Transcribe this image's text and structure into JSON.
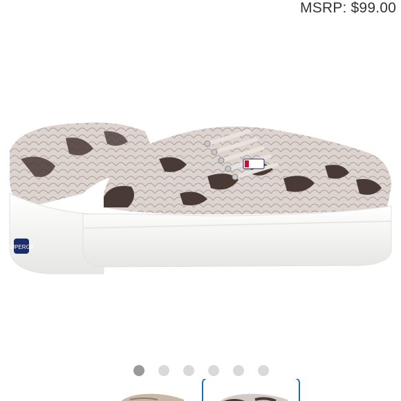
{
  "price": {
    "msrp_label": "MSRP: $99.00"
  },
  "product": {
    "image_icon": "sneaker-product-image",
    "colors": {
      "sole": "#f4f4f2",
      "snake_light": "#d8cfca",
      "snake_dark": "#4a3a36",
      "lace": "#e8e3dc",
      "logo_accent": "#1a2c6b"
    }
  },
  "carousel": {
    "dot_count": 6,
    "active_index": 0
  },
  "thumbnails": {
    "selected_index": 1,
    "accent": "#1a6fa8"
  }
}
